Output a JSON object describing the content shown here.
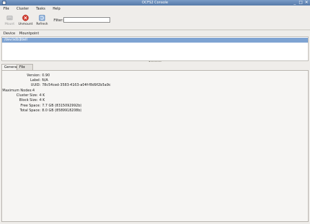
{
  "window": {
    "title": "OCFS2 Console",
    "controls": [
      "_",
      "□",
      "✕"
    ]
  },
  "menu": {
    "file": "File",
    "cluster": "Cluster",
    "tasks": "Tasks",
    "help": "Help"
  },
  "toolbar": {
    "mount_label": "Mount",
    "unmount_label": "Unmount",
    "refresh_label": "Refresh",
    "filter_label": "Filter:",
    "filter_value": ""
  },
  "list": {
    "columns": [
      "Device",
      "Mountpoint"
    ],
    "rows": [
      {
        "device": "/dev/sdb1",
        "mountpoint": "/dell"
      }
    ]
  },
  "tabs": {
    "general": "General",
    "file_listing": "File Listing"
  },
  "general": {
    "fields": [
      {
        "key": "Version:",
        "value": "0.90"
      },
      {
        "key": "Label:",
        "value": "N/A"
      },
      {
        "key": "UUID:",
        "value": "78c54ced-3583-4163-a04f-f8d9f2b5a9c"
      },
      {
        "key": "Maximum Nodes:",
        "value": "4"
      },
      {
        "key": "Cluster Size:",
        "value": "4 K"
      },
      {
        "key": "Block Size:",
        "value": "4 K"
      },
      {
        "key": "Free Space:",
        "value": "7.7 GB (8315092992b)"
      },
      {
        "key": "Total Space:",
        "value": "8.0 GB (8589918208b)"
      }
    ]
  },
  "colors": {
    "selection": "#7ea3d2",
    "titlebar": "#5579a8",
    "unmount_red": "#d23b2f"
  }
}
